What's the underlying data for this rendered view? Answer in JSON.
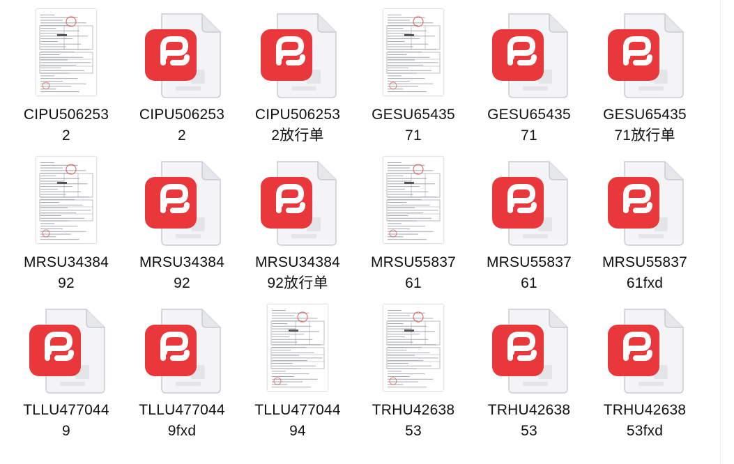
{
  "accent_color": "#e8383b",
  "files": [
    {
      "name": "CIPU5062532",
      "label": "CIPU506253\n2",
      "kind": "scan"
    },
    {
      "name": "CIPU5062532",
      "label": "CIPU506253\n2",
      "kind": "pdf"
    },
    {
      "name": "CIPU5062532放行单",
      "label": "CIPU506253\n2放行单",
      "kind": "pdf"
    },
    {
      "name": "GESU6543571",
      "label": "GESU65435\n71",
      "kind": "scan"
    },
    {
      "name": "GESU6543571",
      "label": "GESU65435\n71",
      "kind": "pdf"
    },
    {
      "name": "GESU6543571放行单",
      "label": "GESU65435\n71放行单",
      "kind": "pdf"
    },
    {
      "name": "MRSU3438492",
      "label": "MRSU34384\n92",
      "kind": "scan"
    },
    {
      "name": "MRSU3438492",
      "label": "MRSU34384\n92",
      "kind": "pdf"
    },
    {
      "name": "MRSU3438492放行单",
      "label": "MRSU34384\n92放行单",
      "kind": "pdf"
    },
    {
      "name": "MRSU5583761",
      "label": "MRSU55837\n61",
      "kind": "scan"
    },
    {
      "name": "MRSU5583761",
      "label": "MRSU55837\n61",
      "kind": "pdf"
    },
    {
      "name": "MRSU5583761fxd",
      "label": "MRSU55837\n61fxd",
      "kind": "pdf"
    },
    {
      "name": "TLLU4770449",
      "label": "TLLU477044\n9",
      "kind": "pdf"
    },
    {
      "name": "TLLU4770449fxd",
      "label": "TLLU477044\n9fxd",
      "kind": "pdf"
    },
    {
      "name": "TLLU47704494",
      "label": "TLLU477044\n94",
      "kind": "scan"
    },
    {
      "name": "TRHU4263853",
      "label": "TRHU42638\n53",
      "kind": "scan"
    },
    {
      "name": "TRHU4263853",
      "label": "TRHU42638\n53",
      "kind": "pdf"
    },
    {
      "name": "TRHU4263853fxd",
      "label": "TRHU42638\n53fxd",
      "kind": "pdf"
    }
  ]
}
